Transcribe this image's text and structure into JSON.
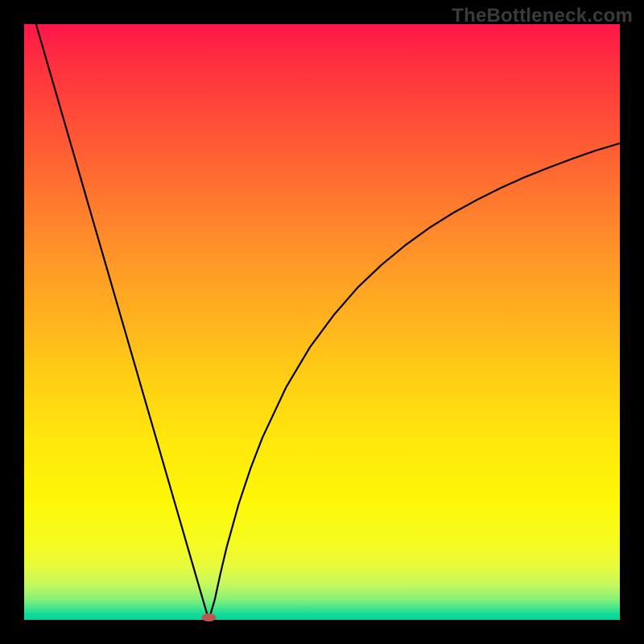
{
  "watermark": "TheBottleneck.com",
  "chart_data": {
    "type": "line",
    "title": "",
    "xlabel": "",
    "ylabel": "",
    "xlim": [
      0,
      100
    ],
    "ylim": [
      0,
      100
    ],
    "background_gradient": {
      "direction": "vertical",
      "stops": [
        {
          "pos": 0,
          "color": "#ff154b"
        },
        {
          "pos": 10,
          "color": "#ff3a3c"
        },
        {
          "pos": 30,
          "color": "#ff7a2e"
        },
        {
          "pos": 50,
          "color": "#ffb41e"
        },
        {
          "pos": 70,
          "color": "#ffe70c"
        },
        {
          "pos": 87,
          "color": "#f6fb20"
        },
        {
          "pos": 94,
          "color": "#c6f85e"
        },
        {
          "pos": 98,
          "color": "#46e58c"
        },
        {
          "pos": 100,
          "color": "#00d79c"
        }
      ]
    },
    "series": [
      {
        "name": "curve",
        "color": "#000000",
        "x": [
          2,
          4,
          6,
          8,
          10,
          12,
          14,
          16,
          18,
          20,
          22,
          24,
          26,
          28,
          30,
          31,
          32,
          33,
          34,
          36,
          38,
          40,
          44,
          48,
          52,
          56,
          60,
          64,
          68,
          72,
          76,
          80,
          84,
          88,
          92,
          96,
          100
        ],
        "values": [
          100,
          93.1,
          86.2,
          79.3,
          72.4,
          65.5,
          58.6,
          51.7,
          44.8,
          37.9,
          31.0,
          24.1,
          17.2,
          10.3,
          3.4,
          0.0,
          3.4,
          8.0,
          12.2,
          19.4,
          25.4,
          30.6,
          39.1,
          45.8,
          51.2,
          55.8,
          59.6,
          62.9,
          65.8,
          68.3,
          70.5,
          72.5,
          74.3,
          75.9,
          77.4,
          78.8,
          80.0
        ]
      }
    ],
    "marker": {
      "x": 31,
      "y": 0,
      "color": "#c1554e",
      "rx": 9,
      "ry": 5
    }
  }
}
